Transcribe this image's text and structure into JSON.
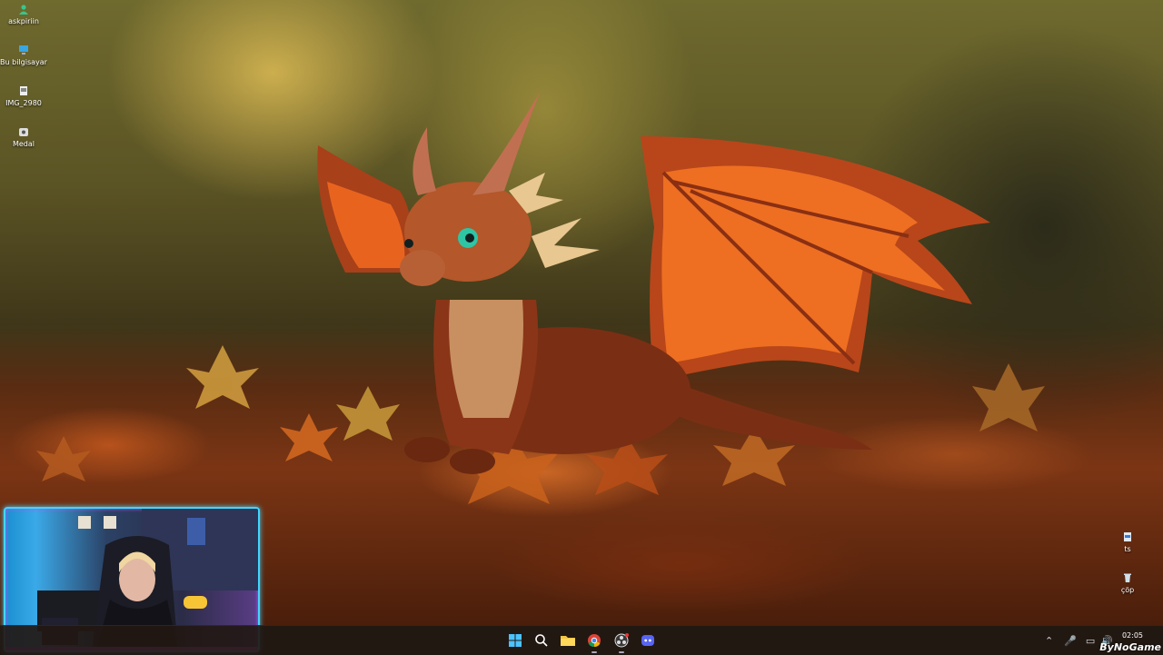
{
  "desktop": {
    "icons": [
      {
        "label": "askpiriin",
        "icon": "user-folder-icon"
      },
      {
        "label": "Bu bilgisayar",
        "icon": "computer-icon"
      },
      {
        "label": "IMG_2980",
        "icon": "image-file-icon"
      },
      {
        "label": "Medal",
        "icon": "medal-app-icon"
      }
    ],
    "right_icons": [
      {
        "label": "ts",
        "icon": "file-icon"
      },
      {
        "label": "çöp",
        "icon": "recycle-bin-icon"
      }
    ]
  },
  "taskbar": {
    "apps": [
      {
        "name": "start",
        "icon": "windows-start-icon"
      },
      {
        "name": "search",
        "icon": "search-icon"
      },
      {
        "name": "file-explorer",
        "icon": "folder-icon"
      },
      {
        "name": "chrome",
        "icon": "chrome-icon"
      },
      {
        "name": "obs",
        "icon": "obs-icon"
      },
      {
        "name": "discord",
        "icon": "discord-icon"
      }
    ],
    "tray_icons": [
      "chevron-up-icon",
      "microphone-icon",
      "display-icon",
      "speaker-icon"
    ],
    "clock": {
      "time": "02:05",
      "date": ""
    }
  },
  "watermark": "ByNoGame",
  "colors": {
    "accent_cyan": "#41d6ff",
    "accent_magenta": "#d44bff"
  }
}
